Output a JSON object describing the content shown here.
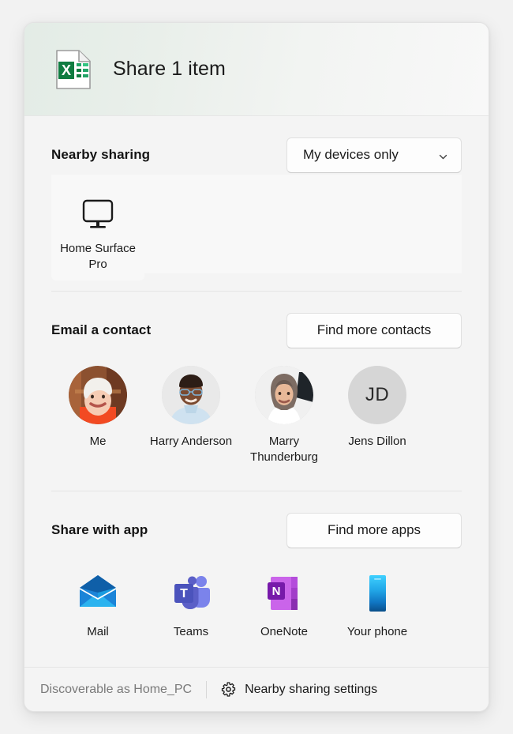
{
  "header": {
    "title": "Share 1 item",
    "file_icon": "excel-file-icon",
    "accent": "#107c41"
  },
  "nearby": {
    "title": "Nearby sharing",
    "dropdown_value": "My devices only",
    "dropdown_icon": "chevron-down-icon",
    "devices": [
      {
        "name": "Home Surface Pro",
        "icon": "monitor-icon"
      }
    ]
  },
  "contacts": {
    "title": "Email a contact",
    "button_label": "Find more contacts",
    "items": [
      {
        "name": "Me",
        "avatar": "photo",
        "initials": ""
      },
      {
        "name": "Harry Anderson",
        "avatar": "photo",
        "initials": ""
      },
      {
        "name": "Marry Thunderburg",
        "avatar": "photo",
        "initials": ""
      },
      {
        "name": "Jens Dillon",
        "avatar": "initials",
        "initials": "JD"
      }
    ]
  },
  "apps": {
    "title": "Share with app",
    "button_label": "Find more apps",
    "items": [
      {
        "name": "Mail",
        "icon": "mail-icon",
        "color": "#1e9ae0"
      },
      {
        "name": "Teams",
        "icon": "teams-icon",
        "color": "#5b5fc7"
      },
      {
        "name": "OneNote",
        "icon": "onenote-icon",
        "color": "#b04cd4"
      },
      {
        "name": "Your phone",
        "icon": "phone-icon",
        "color": "#2ec5f5"
      }
    ]
  },
  "footer": {
    "status": "Discoverable as Home_PC",
    "settings_label": "Nearby sharing settings",
    "settings_icon": "gear-icon"
  }
}
